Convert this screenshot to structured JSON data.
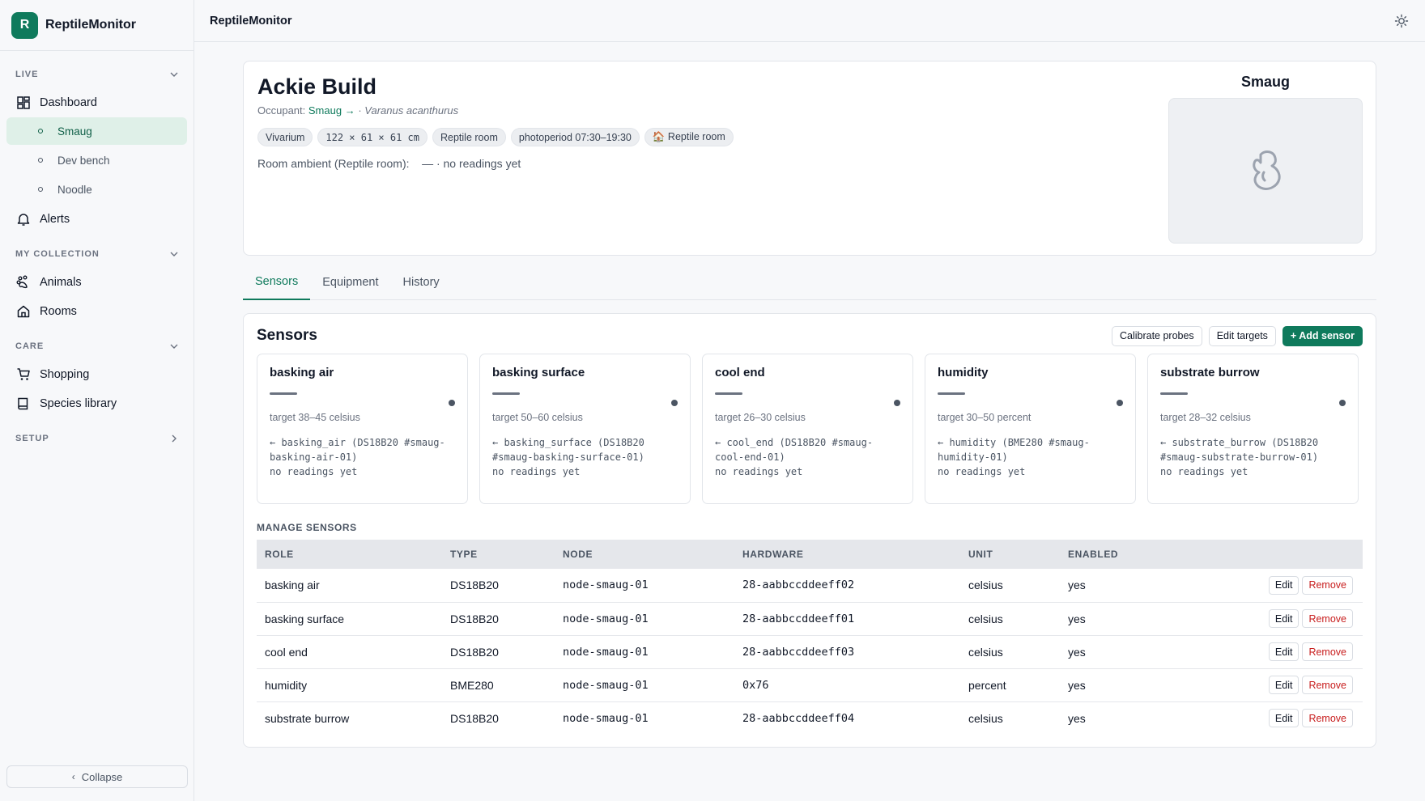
{
  "app": {
    "name": "ReptileMonitor",
    "logo_letter": "R"
  },
  "topbar": {
    "title": "ReptileMonitor",
    "theme_icon": "sun-icon"
  },
  "sidebar": {
    "live_label": "LIVE",
    "dashboard_label": "Dashboard",
    "enclosures": [
      {
        "label": "Smaug",
        "active": true
      },
      {
        "label": "Dev bench"
      },
      {
        "label": "Noodle"
      }
    ],
    "alerts_label": "Alerts",
    "collection_label": "MY COLLECTION",
    "animals_label": "Animals",
    "rooms_label": "Rooms",
    "care_label": "CARE",
    "shopping_label": "Shopping",
    "species_label": "Species library",
    "setup_label": "SETUP",
    "collapse_label": "Collapse"
  },
  "enclosure": {
    "title": "Ackie Build",
    "occupant_prefix": "Occupant:",
    "occupant_name": "Smaug →",
    "occupant_sep": "·",
    "species": "Varanus acanthurus",
    "chips": {
      "type": "Vivarium",
      "dimensions": "122 × 61 × 61 cm",
      "room": "Reptile room",
      "photoperiod": "photoperiod 07:30–19:30",
      "room_link": "🏠 Reptile room"
    },
    "ambient": "Room ambient (Reptile room):    — · no readings yet",
    "occupant_panel_name": "Smaug"
  },
  "tabs": [
    {
      "label": "Sensors",
      "active": true
    },
    {
      "label": "Equipment"
    },
    {
      "label": "History"
    }
  ],
  "sensors": {
    "title": "Sensors",
    "buttons": {
      "calibrate": "Calibrate probes",
      "edit_targets": "Edit targets",
      "add": "+ Add sensor"
    },
    "tiles": [
      {
        "name": "basking air",
        "target": "target 38–45 celsius",
        "source_1": "← basking_air (DS18B20 #smaug-",
        "source_2": "basking-air-01)",
        "status": "no readings yet"
      },
      {
        "name": "basking surface",
        "target": "target 50–60 celsius",
        "source_1": "← basking_surface (DS18B20",
        "source_2": "#smaug-basking-surface-01)",
        "status": "no readings yet"
      },
      {
        "name": "cool end",
        "target": "target 26–30 celsius",
        "source_1": "← cool_end (DS18B20 #smaug-",
        "source_2": "cool-end-01)",
        "status": "no readings yet"
      },
      {
        "name": "humidity",
        "target": "target 30–50 percent",
        "source_1": "← humidity (BME280 #smaug-",
        "source_2": "humidity-01)",
        "status": "no readings yet"
      },
      {
        "name": "substrate burrow",
        "target": "target 28–32 celsius",
        "source_1": "← substrate_burrow (DS18B20",
        "source_2": "#smaug-substrate-burrow-01)",
        "status": "no readings yet"
      }
    ],
    "manage_label": "MANAGE SENSORS",
    "columns": [
      "ROLE",
      "TYPE",
      "NODE",
      "HARDWARE",
      "UNIT",
      "ENABLED"
    ],
    "rows": [
      {
        "role": "basking air",
        "type": "DS18B20",
        "node": "node-smaug-01",
        "hardware": "28-aabbccddeeff02",
        "unit": "celsius",
        "enabled": "yes"
      },
      {
        "role": "basking surface",
        "type": "DS18B20",
        "node": "node-smaug-01",
        "hardware": "28-aabbccddeeff01",
        "unit": "celsius",
        "enabled": "yes"
      },
      {
        "role": "cool end",
        "type": "DS18B20",
        "node": "node-smaug-01",
        "hardware": "28-aabbccddeeff03",
        "unit": "celsius",
        "enabled": "yes"
      },
      {
        "role": "humidity",
        "type": "BME280",
        "node": "node-smaug-01",
        "hardware": "0x76",
        "unit": "percent",
        "enabled": "yes"
      },
      {
        "role": "substrate burrow",
        "type": "DS18B20",
        "node": "node-smaug-01",
        "hardware": "28-aabbccddeeff04",
        "unit": "celsius",
        "enabled": "yes"
      }
    ],
    "edit_label": "Edit",
    "remove_label": "Remove"
  },
  "colors": {
    "accent": "#0f7a5c",
    "active_bg": "#dff0e8",
    "danger": "#c81e1e"
  }
}
